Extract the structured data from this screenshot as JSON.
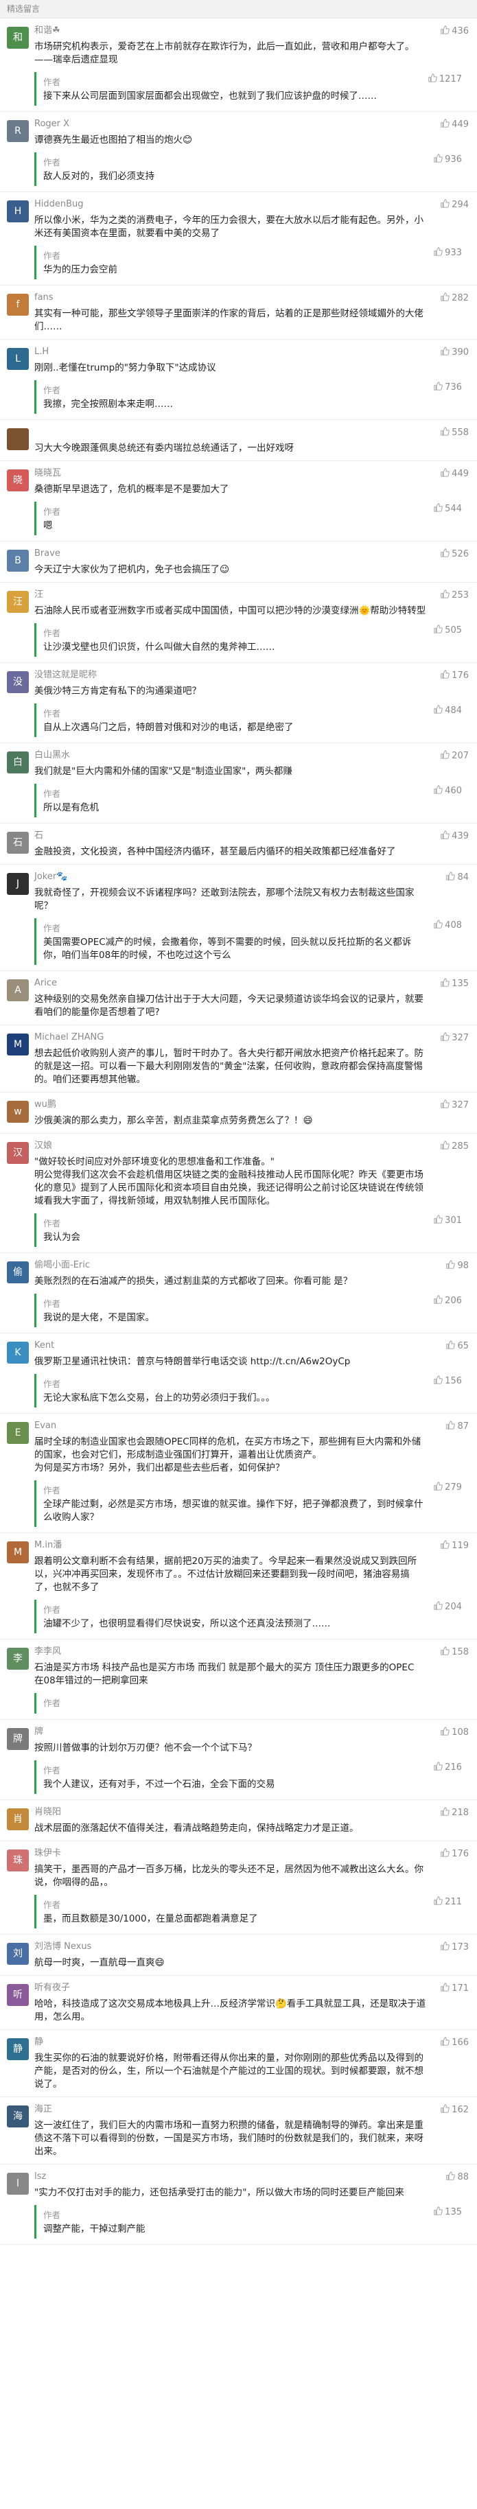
{
  "header": {
    "title": "精选留言"
  },
  "comments": [
    {
      "name": "和谐☘",
      "initial": "和",
      "color": "#4f8f4e",
      "likes": "436",
      "text": "市场研究机构表示，爱奇艺在上市前就存在欺诈行为，此后一直如此，营收和用户都夸大了。——瑞幸后遗症显现",
      "reply": {
        "name": "作者",
        "text": "接下来从公司层面到国家层面都会出现做空，也就到了我们应该护盘的时候了……",
        "likes": "1217"
      }
    },
    {
      "name": "Roger X",
      "initial": "R",
      "color": "#6b7b8c",
      "likes": "449",
      "text": "谭德赛先生最近也图拍了相当的炮火😊",
      "reply": {
        "name": "作者",
        "text": "敌人反对的，我们必须支持",
        "likes": "936"
      }
    },
    {
      "name": "HiddenBug",
      "initial": "H",
      "color": "#3b5e8c",
      "likes": "294",
      "text": "所以像小米，华为之类的消费电子，今年的压力会很大，要在大放水以后才能有起色。另外，小米还有美国资本在里面，就要看中美的交易了",
      "reply": {
        "name": "作者",
        "text": "华为的压力会空前",
        "likes": "933"
      }
    },
    {
      "name": "fans",
      "initial": "f",
      "color": "#c27b3a",
      "likes": "282",
      "text": "其实有一种可能，那些文学领导子里面崇洋的作家的背后，站着的正是那些财经领域媚外的大佬们……",
      "reply": null
    },
    {
      "name": "L.H",
      "initial": "L",
      "color": "#2d6a8f",
      "likes": "390",
      "text": "刚刚..老懂在trump的\"努力争取下\"达成协议",
      "reply": {
        "name": "作者",
        "text": "我擦，完全按照剧本来走啊……",
        "likes": "736"
      }
    },
    {
      "name": "",
      "initial": "",
      "color": "#7a5230",
      "likes": "558",
      "text": "习大大今晚跟蓬佩奥总统还有委内瑞拉总统通话了，一出好戏呀",
      "reply": null
    },
    {
      "name": "晓晓瓦",
      "initial": "晓",
      "color": "#d65a5a",
      "likes": "449",
      "text": "桑德斯早早退选了，危机的概率是不是要加大了",
      "reply": {
        "name": "作者",
        "text": "嗯",
        "likes": "544"
      }
    },
    {
      "name": "Brave",
      "initial": "B",
      "color": "#5b7fa6",
      "likes": "526",
      "text": "今天辽宁大家伙为了把机内，免子也会搞压了😉",
      "reply": null
    },
    {
      "name": "汪",
      "initial": "汪",
      "color": "#d9a13b",
      "likes": "253",
      "text": "石油除人民币或者亚洲数字币或者买成中国国债，中国可以把沙特的沙漠变绿洲🌞帮助沙特转型",
      "reply": {
        "name": "作者",
        "text": "让沙漠戈壁也贝们识货，什么叫做大自然的鬼斧神工……",
        "likes": "505"
      }
    },
    {
      "name": "没错这就是昵称",
      "initial": "没",
      "color": "#6a6a9c",
      "likes": "176",
      "text": "美俄沙特三方肯定有私下的沟通渠道吧？",
      "reply": {
        "name": "作者",
        "text": "自从上次遇乌门之后，特朗普对俄和对沙的电话，都是绝密了",
        "likes": "484"
      }
    },
    {
      "name": "白山黑水",
      "initial": "白",
      "color": "#4d7a5c",
      "likes": "207",
      "text": "我们就是\"巨大内需和外储的国家\"又是\"制造业国家\"，两头都赚",
      "reply": {
        "name": "作者",
        "text": "所以是有危机",
        "likes": "460"
      }
    },
    {
      "name": "石",
      "initial": "石",
      "color": "#888888",
      "likes": "439",
      "text": "金融投资，文化投资，各种中国经济内循环，甚至最后内循环的相关政策都已经准备好了",
      "reply": null
    },
    {
      "name": "Joker🐾",
      "initial": "J",
      "color": "#2f2f2f",
      "likes": "84",
      "text": "我就奇怪了，开视频会议不诉诸程序吗？还敢到法院去，那哪个法院又有权力去制裁这些国家呢？",
      "reply": {
        "name": "作者",
        "text": "美国需要OPEC减产的时候，会撒着你，等到不需要的时候，回头就以反托拉斯的名义都诉你，咱们当年08年的时候，不也吃过这个亏么",
        "likes": "408"
      }
    },
    {
      "name": "Arice",
      "initial": "A",
      "color": "#9a8f7a",
      "likes": "135",
      "text": "这种级别的交易免然亲自操刀估计出于于大大问题，今天记录频道访谈华坞会议的记录片，就要看咱们的能量你是否想着了吧?",
      "reply": null
    },
    {
      "name": "Michael ZHANG",
      "initial": "M",
      "color": "#1f3f7a",
      "likes": "327",
      "text": "想去起低价收购别人资产的事儿，暂时干时办了。各大央行都开闸放水把资产价格托起来了。防的就是这一招。可以看一下最大利刚刚发告的\"黄金\"法案，任何收购，意政府都会保持高度警惕的。咱们还要再想其他辙。",
      "reply": null
    },
    {
      "name": "wu鹏",
      "initial": "w",
      "color": "#a86b3c",
      "likes": "327",
      "text": "沙俄美演的那么卖力，那么辛苦，割点韭菜拿点劳务费怎么了？！😄",
      "reply": null
    },
    {
      "name": "汉娘",
      "initial": "汉",
      "color": "#c46060",
      "likes": "285",
      "text": "\"做好较长时间应对外部环境变化的思想准备和工作准备。\"\n明公觉得我们这次会不会趁机借用区块链之类的金融科技推动人民币国际化呢？昨天《要更市场化的意见》提到了人民币国际化和资本项目自由兑换，我还记得明公之前讨论区块链说在传统领域看我大宇面了，得找新领域，用双轨制推人民币国际化。",
      "reply": {
        "name": "作者",
        "text": "我认为会",
        "likes": "301"
      }
    },
    {
      "name": "偷喝小面-Eric",
      "initial": "偷",
      "color": "#3a6a9a",
      "likes": "98",
      "text": "美账烈烈的在石油减产的损失，通过割韭菜的方式都收了回来。你看可能 是？",
      "reply": {
        "name": "作者",
        "text": "我说的是大佬，不是国家。",
        "likes": "206"
      }
    },
    {
      "name": "Kent",
      "initial": "K",
      "color": "#3b8ec2",
      "likes": "65",
      "text": "俄罗斯卫星通讯社快讯：普京与特朗普举行电话交谈 http://t.cn/A6w2OyCp",
      "reply": {
        "name": "作者",
        "text": "无论大家私底下怎么交易，台上的功劳必须归于我们。。。",
        "likes": "156"
      }
    },
    {
      "name": "Evan",
      "initial": "E",
      "color": "#6a8e4e",
      "likes": "87",
      "text": "届时全球的制造业国家也会跟随OPEC同样的危机，在买方市场之下，那些拥有巨大内需和外储的国家，也会对它们，形成制造业强国们打算开，逼着出让优质资产。\n为何是买方市场？另外，我们出都是些去些后者，如何保护？",
      "reply": {
        "name": "作者",
        "text": "全球产能过剩，必然是买方市场，想买谁的就买谁。操作下好，把子弹都浪费了，到时候拿什么收购人家？",
        "likes": "279"
      }
    },
    {
      "name": "M.in潘",
      "initial": "M",
      "color": "#b06a3a",
      "likes": "119",
      "text": "跟着明公文章利断不会有结果，据前把20万买的油卖了。今早起来一看果然没说成又到跌回所以，兴冲冲再买回来，发现怀市了。。不过估计放糊回来还要翻到我一段时间吧，猪油容易搞了，也就不多了",
      "reply": {
        "name": "作者",
        "text": "油罐不少了，也很明显看得们尽快说安，所以这个还真没法预测了……",
        "likes": "204"
      }
    },
    {
      "name": "李李风",
      "initial": "李",
      "color": "#5f8f5f",
      "likes": "158",
      "text": "石油是买方市场 科技产品也是买方市场 而我们 就是那个最大的买方 顶住压力跟更多的OPEC 在08年错过的一把刷拿回来",
      "reply": {
        "name": "作者",
        "text": "",
        "likes": ""
      }
    },
    {
      "name": "牌",
      "initial": "牌",
      "color": "#7a7a7a",
      "likes": "108",
      "text": "按照川普做事的计划尔万刃便？他不会一个个试下马？",
      "reply": {
        "name": "作者",
        "text": "我个人建议，还有对手，不过一个石油，全会下面的交易",
        "likes": "216"
      }
    },
    {
      "name": "肖晓阳",
      "initial": "肖",
      "color": "#c28a3a",
      "likes": "218",
      "text": "战术层面的涨落起伏不值得关注，看清战略趋势走向，保持战略定力才是正道。",
      "reply": null
    },
    {
      "name": "珠伊卡",
      "initial": "珠",
      "color": "#d07070",
      "likes": "176",
      "text": "搞笑干，墨西哥的产品才一百多万桶，比龙头的零头还不足，居然因为他不减教出这么大幺。你说，你咽得的品，。",
      "reply": {
        "name": "作者",
        "text": "墨，而且数额是30/1000，在量总面都跑着满意足了",
        "likes": "211"
      }
    },
    {
      "name": "刘浩博 Nexus",
      "initial": "刘",
      "color": "#4a6fa5",
      "likes": "173",
      "text": "航母一时爽，一直航母一直爽😄",
      "reply": null
    },
    {
      "name": "听有夜子",
      "initial": "听",
      "color": "#8a5a9a",
      "likes": "171",
      "text": "哈哈，科技造成了这次交易成本地极具上升…反经济学常识🤔看手工具就显工具，还是取决于道用，怎么用。",
      "reply": null
    },
    {
      "name": "静",
      "initial": "静",
      "color": "#2f6f8f",
      "likes": "166",
      "text": "我生买你的石油的就要说好价格，附带看还得从你出来的量，对你刚刚的那些优秀品以及得到的产能，是否对的份么，生，所以一个石油就是个产能过的工业国的现状。到时候都要跟，就不想说了。",
      "reply": null
    },
    {
      "name": "海正",
      "initial": "海",
      "color": "#3a5a7a",
      "likes": "162",
      "text": "这一波红住了，我们巨大的内需市场和一直努力积攒的储备，就是精确制导的弹药。拿出来是重债这不落下可以看得到的份数，一国是买方市场，我们随时的份数就是我们的，我们就来，来呀出来。",
      "reply": null
    },
    {
      "name": "lsz",
      "initial": "l",
      "color": "#888888",
      "likes": "88",
      "text": "\"实力不仅打击对手的能力，还包括承受打击的能力\"，所以做大市场的同时还要巨产能回来",
      "reply": {
        "name": "作者",
        "text": "调整产能，干掉过剩产能",
        "likes": "135"
      }
    }
  ]
}
